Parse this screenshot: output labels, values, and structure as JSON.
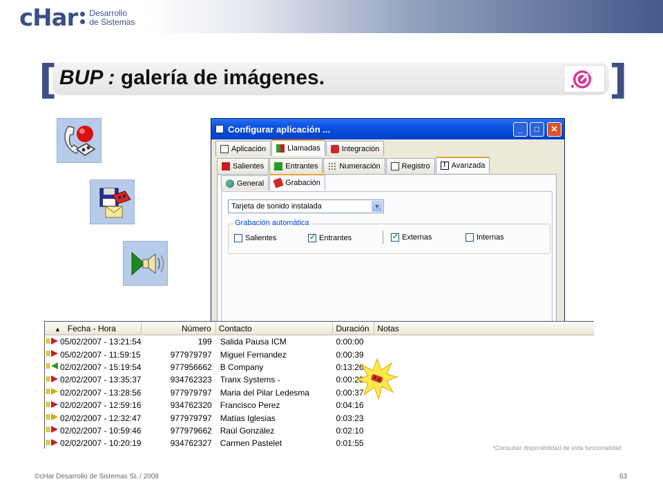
{
  "brand": {
    "logo_text": "cHar",
    "logo_line1": "Desarrollo",
    "logo_line2": "de Sistemas"
  },
  "slide": {
    "title_prefix": "BUP :",
    "title_main": "galería de imágenes."
  },
  "left_icons": [
    "phone-record-icon",
    "save-mail-icon",
    "play-speaker-icon"
  ],
  "dialog": {
    "title": "Configurar aplicación ...",
    "tabs_top": [
      {
        "label": "Aplicación",
        "icon": "app-icon"
      },
      {
        "label": "Llamadas",
        "icon": "calls-icon",
        "active": true
      },
      {
        "label": "Integración",
        "icon": "integration-icon"
      }
    ],
    "tabs_mid": [
      {
        "label": "Salientes",
        "icon": "outgoing-icon"
      },
      {
        "label": "Entrantes",
        "icon": "incoming-icon"
      },
      {
        "label": "Numeración",
        "icon": "keypad-icon"
      },
      {
        "label": "Registro",
        "icon": "register-icon"
      },
      {
        "label": "Avanzada",
        "icon": "warning-icon",
        "active": true
      }
    ],
    "tabs_sub": [
      {
        "label": "General",
        "icon": "globe-icon"
      },
      {
        "label": "Grabación",
        "icon": "tape-icon",
        "active": true
      }
    ],
    "combo_value": "Tarjeta de sonido instalada",
    "group_label": "Grabación automática",
    "checks": [
      {
        "label": "Salientes",
        "checked": false
      },
      {
        "label": "Entrantes",
        "checked": true
      },
      {
        "label": "Externas",
        "checked": true
      },
      {
        "label": "Internas",
        "checked": false
      }
    ]
  },
  "calls_list": {
    "columns": [
      "Fecha - Hora",
      "Número",
      "Contacto",
      "Duración",
      "Notas"
    ],
    "rows": [
      {
        "dir": "out",
        "fecha": "05/02/2007 - 13:21:54",
        "numero": "199",
        "contacto": "Salida Pausa ICM",
        "duracion": "0:00:00",
        "notas": ""
      },
      {
        "dir": "out",
        "fecha": "05/02/2007 - 11:59:15",
        "numero": "977979797",
        "contacto": "Miguel Fernandez",
        "duracion": "0:00:39",
        "notas": ""
      },
      {
        "dir": "in",
        "fecha": "02/02/2007 - 15:19:54",
        "numero": "977956662",
        "contacto": "B Company",
        "duracion": "0:13:26",
        "notas": ""
      },
      {
        "dir": "out",
        "fecha": "02/02/2007 - 13:35:37",
        "numero": "934762323",
        "contacto": "Tranx Systems -",
        "duracion": "0:00:23",
        "notas": ""
      },
      {
        "dir": "missed",
        "fecha": "02/02/2007 - 13:28:56",
        "numero": "977979797",
        "contacto": "Maria del Pilar Ledesma",
        "duracion": "0:00:37",
        "notas": ""
      },
      {
        "dir": "out",
        "fecha": "02/02/2007 - 12:59:16",
        "numero": "934762320",
        "contacto": "Francisco Perez",
        "duracion": "0:04:16",
        "notas": ""
      },
      {
        "dir": "missed",
        "fecha": "02/02/2007 - 12:32:47",
        "numero": "977979797",
        "contacto": "Matías Iglesias",
        "duracion": "0:03:23",
        "notas": ""
      },
      {
        "dir": "out",
        "fecha": "02/02/2007 - 10:59:46",
        "numero": "977979662",
        "contacto": "Raúl González",
        "duracion": "0:02:10",
        "notas": ""
      },
      {
        "dir": "out",
        "fecha": "02/02/2007 - 10:20:19",
        "numero": "934762327",
        "contacto": "Carmen Pastelet",
        "duracion": "0:01:55",
        "notas": ""
      }
    ]
  },
  "note": "*Consultar disponibilidad de esta funcionalidad",
  "footer": "©cHar Desarrollo de Sistemas SL / 2008",
  "page_number": "63",
  "colors": {
    "brand_blue": "#3c4f86",
    "xp_title": "#0a52e0",
    "out_arrow": "#c81e1e",
    "in_arrow": "#2a9a2a",
    "missed_arrow": "#c8b400"
  }
}
